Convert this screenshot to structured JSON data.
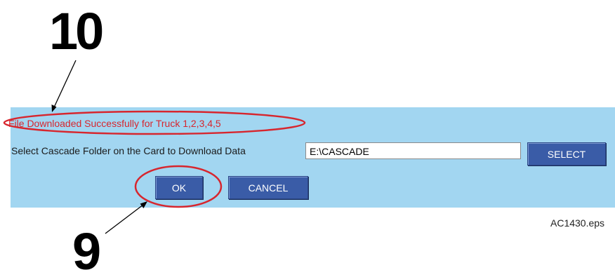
{
  "callouts": {
    "top_number": "10",
    "bottom_number": "9"
  },
  "status": {
    "message": "File Downloaded Successfully for Truck 1,2,3,4,5",
    "color": "#d7262e"
  },
  "folder": {
    "label": "Select Cascade Folder on the Card to Download Data",
    "value": "E:\\CASCADE"
  },
  "buttons": {
    "select_label": "SELECT",
    "ok_label": "OK",
    "cancel_label": "CANCEL"
  },
  "caption": "AC1430.eps",
  "colors": {
    "panel_background": "#a2d6f1",
    "button_background": "#3a5ca7",
    "highlight_ellipse": "#d7262e"
  }
}
